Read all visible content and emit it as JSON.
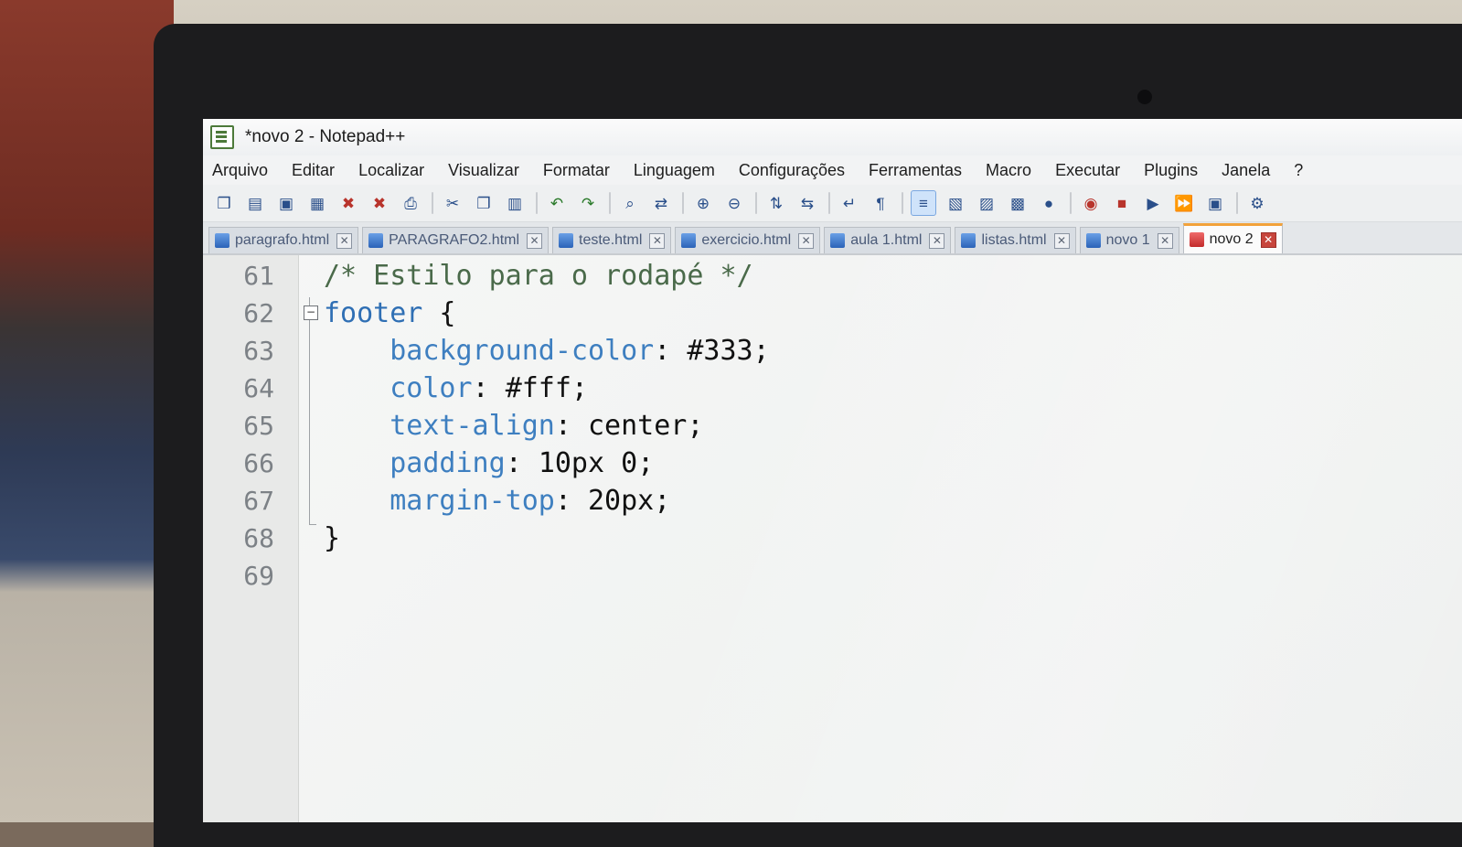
{
  "window": {
    "title": "*novo 2 - Notepad++"
  },
  "menubar": {
    "items": [
      "Arquivo",
      "Editar",
      "Localizar",
      "Visualizar",
      "Formatar",
      "Linguagem",
      "Configurações",
      "Ferramentas",
      "Macro",
      "Executar",
      "Plugins",
      "Janela",
      "?"
    ]
  },
  "toolbar": {
    "icons": [
      "new-file-icon",
      "open-file-icon",
      "save-icon",
      "save-all-icon",
      "close-icon",
      "close-all-icon",
      "print-icon",
      "cut-icon",
      "copy-icon",
      "paste-icon",
      "undo-icon",
      "redo-icon",
      "find-icon",
      "replace-icon",
      "zoom-in-icon",
      "zoom-out-icon",
      "sync-vertical-icon",
      "sync-horizontal-icon",
      "word-wrap-icon",
      "show-all-characters-icon",
      "indent-guide-icon",
      "doc-map-icon",
      "function-list-icon",
      "folder-as-workspace-icon",
      "monitoring-icon",
      "start-recording-icon",
      "stop-recording-icon",
      "playback-icon",
      "run-macro-multiple-icon",
      "save-macro-icon",
      "plugin-icon"
    ]
  },
  "tabs": [
    {
      "label": "paragrafo.html",
      "active": false
    },
    {
      "label": "PARAGRAFO2.html",
      "active": false
    },
    {
      "label": "teste.html",
      "active": false
    },
    {
      "label": "exercicio.html",
      "active": false
    },
    {
      "label": "aula 1.html",
      "active": false
    },
    {
      "label": "listas.html",
      "active": false
    },
    {
      "label": "novo 1",
      "active": false
    },
    {
      "label": "novo 2",
      "active": true
    }
  ],
  "editor": {
    "lines": [
      {
        "num": "61",
        "tokens": [
          {
            "t": "cm",
            "v": "/* Estilo para o rodapé */"
          }
        ]
      },
      {
        "num": "62",
        "tokens": [
          {
            "t": "kw",
            "v": "footer"
          },
          {
            "t": "pun",
            "v": " {"
          }
        ]
      },
      {
        "num": "63",
        "tokens": [
          {
            "t": "sp",
            "v": "    "
          },
          {
            "t": "prop",
            "v": "background-color"
          },
          {
            "t": "pun",
            "v": ": "
          },
          {
            "t": "val",
            "v": "#333;"
          }
        ]
      },
      {
        "num": "64",
        "tokens": [
          {
            "t": "sp",
            "v": "    "
          },
          {
            "t": "prop",
            "v": "color"
          },
          {
            "t": "pun",
            "v": ": "
          },
          {
            "t": "val",
            "v": "#fff;"
          }
        ]
      },
      {
        "num": "65",
        "tokens": [
          {
            "t": "sp",
            "v": "    "
          },
          {
            "t": "prop",
            "v": "text-align"
          },
          {
            "t": "pun",
            "v": ": "
          },
          {
            "t": "val",
            "v": "center;"
          }
        ]
      },
      {
        "num": "66",
        "tokens": [
          {
            "t": "sp",
            "v": "    "
          },
          {
            "t": "prop",
            "v": "padding"
          },
          {
            "t": "pun",
            "v": ": "
          },
          {
            "t": "val",
            "v": "10px 0;"
          }
        ]
      },
      {
        "num": "67",
        "tokens": [
          {
            "t": "sp",
            "v": "    "
          },
          {
            "t": "prop",
            "v": "margin-top"
          },
          {
            "t": "pun",
            "v": ": "
          },
          {
            "t": "val",
            "v": "20px;"
          }
        ]
      },
      {
        "num": "68",
        "tokens": [
          {
            "t": "pun",
            "v": "}"
          }
        ]
      },
      {
        "num": "69",
        "tokens": []
      }
    ]
  }
}
